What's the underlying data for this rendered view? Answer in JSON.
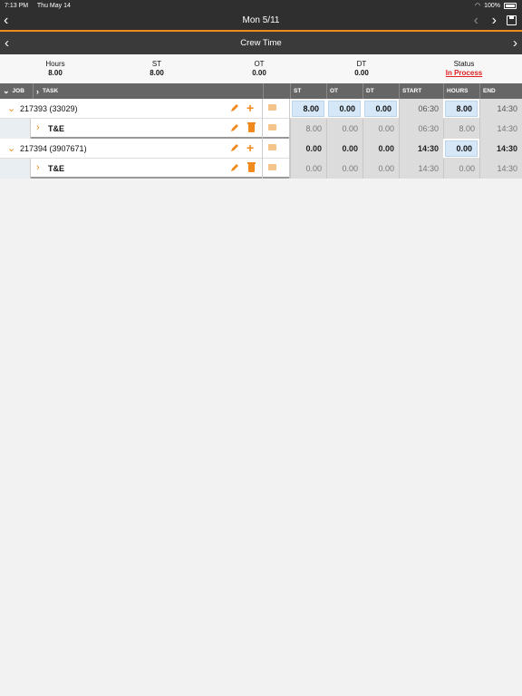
{
  "status_bar": {
    "time": "7:13 PM",
    "date": "Thu May 14",
    "battery": "100%"
  },
  "nav": {
    "title": "Mon 5/11",
    "back_icon": "chevron-left-icon",
    "prev_icon": "chevron-left-icon",
    "next_icon": "chevron-right-icon",
    "save_icon": "save-icon"
  },
  "subnav": {
    "title": "Crew Time"
  },
  "summary": {
    "hours_label": "Hours",
    "hours_value": "8.00",
    "st_label": "ST",
    "st_value": "8.00",
    "ot_label": "OT",
    "ot_value": "0.00",
    "dt_label": "DT",
    "dt_value": "0.00",
    "status_label": "Status",
    "status_value": "In Process"
  },
  "columns": {
    "job": "JOB",
    "task": "TASK",
    "st": "ST",
    "ot": "OT",
    "dt": "DT",
    "start": "START",
    "hours": "HOURS",
    "end": "END"
  },
  "rows": [
    {
      "name": "217393 (33029)",
      "st": "8.00",
      "ot": "0.00",
      "dt": "0.00",
      "start": "06:30",
      "hours": "8.00",
      "end": "14:30"
    },
    {
      "name": "T&E",
      "st": "8.00",
      "ot": "0.00",
      "dt": "0.00",
      "start": "06:30",
      "hours": "8.00",
      "end": "14:30"
    },
    {
      "name": "217394 (3907671)",
      "st": "0.00",
      "ot": "0.00",
      "dt": "0.00",
      "start": "14:30",
      "hours": "0.00",
      "end": "14:30"
    },
    {
      "name": "T&E",
      "st": "0.00",
      "ot": "0.00",
      "dt": "0.00",
      "start": "14:30",
      "hours": "0.00",
      "end": "14:30"
    }
  ],
  "colors": {
    "accent": "#f08a1c",
    "status": "#e02020",
    "header": "#2f2f2f"
  }
}
